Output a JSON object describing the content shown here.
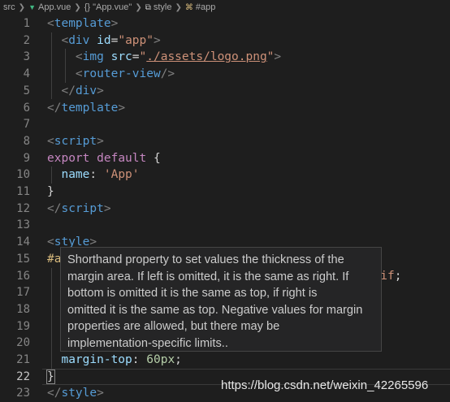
{
  "breadcrumb": {
    "items": [
      "src",
      "App.vue",
      "{} \"App.vue\"",
      "style",
      "#app"
    ]
  },
  "code_lines": [
    {
      "number": "1",
      "tokens": [
        {
          "t": "<",
          "c": "punc"
        },
        {
          "t": "template",
          "c": "tag"
        },
        {
          "t": ">",
          "c": "punc"
        }
      ]
    },
    {
      "number": "2",
      "tokens": [
        {
          "t": "  ",
          "c": "plain"
        },
        {
          "t": "<",
          "c": "punc"
        },
        {
          "t": "div",
          "c": "tag"
        },
        {
          "t": " ",
          "c": "plain"
        },
        {
          "t": "id",
          "c": "attr"
        },
        {
          "t": "=",
          "c": "plain"
        },
        {
          "t": "\"app\"",
          "c": "str"
        },
        {
          "t": ">",
          "c": "punc"
        }
      ]
    },
    {
      "number": "3",
      "tokens": [
        {
          "t": "    ",
          "c": "plain"
        },
        {
          "t": "<",
          "c": "punc"
        },
        {
          "t": "img",
          "c": "tag"
        },
        {
          "t": " ",
          "c": "plain"
        },
        {
          "t": "src",
          "c": "attr"
        },
        {
          "t": "=",
          "c": "plain"
        },
        {
          "t": "\"",
          "c": "str"
        },
        {
          "t": "./assets/logo.png",
          "c": "str link"
        },
        {
          "t": "\"",
          "c": "str"
        },
        {
          "t": ">",
          "c": "punc"
        }
      ]
    },
    {
      "number": "4",
      "tokens": [
        {
          "t": "    ",
          "c": "plain"
        },
        {
          "t": "<",
          "c": "punc"
        },
        {
          "t": "router-view",
          "c": "tag"
        },
        {
          "t": "/>",
          "c": "punc"
        }
      ]
    },
    {
      "number": "5",
      "tokens": [
        {
          "t": "  ",
          "c": "plain"
        },
        {
          "t": "</",
          "c": "punc"
        },
        {
          "t": "div",
          "c": "tag"
        },
        {
          "t": ">",
          "c": "punc"
        }
      ]
    },
    {
      "number": "6",
      "tokens": [
        {
          "t": "</",
          "c": "punc"
        },
        {
          "t": "template",
          "c": "tag"
        },
        {
          "t": ">",
          "c": "punc"
        }
      ]
    },
    {
      "number": "7",
      "tokens": []
    },
    {
      "number": "8",
      "tokens": [
        {
          "t": "<",
          "c": "punc"
        },
        {
          "t": "script",
          "c": "tag"
        },
        {
          "t": ">",
          "c": "punc"
        }
      ]
    },
    {
      "number": "9",
      "tokens": [
        {
          "t": "export",
          "c": "kw"
        },
        {
          "t": " ",
          "c": "plain"
        },
        {
          "t": "default",
          "c": "kw"
        },
        {
          "t": " {",
          "c": "plain"
        }
      ]
    },
    {
      "number": "10",
      "tokens": [
        {
          "t": "  ",
          "c": "plain"
        },
        {
          "t": "name",
          "c": "key"
        },
        {
          "t": ": ",
          "c": "plain"
        },
        {
          "t": "'App'",
          "c": "str"
        }
      ]
    },
    {
      "number": "11",
      "tokens": [
        {
          "t": "}",
          "c": "plain"
        }
      ]
    },
    {
      "number": "12",
      "tokens": [
        {
          "t": "</",
          "c": "punc"
        },
        {
          "t": "script",
          "c": "tag"
        },
        {
          "t": ">",
          "c": "punc"
        }
      ]
    },
    {
      "number": "13",
      "tokens": []
    },
    {
      "number": "14",
      "tokens": [
        {
          "t": "<",
          "c": "punc"
        },
        {
          "t": "style",
          "c": "tag"
        },
        {
          "t": ">",
          "c": "punc"
        }
      ]
    },
    {
      "number": "15",
      "tokens": [
        {
          "t": "#a",
          "c": "sel"
        }
      ]
    },
    {
      "number": "16",
      "tokens": [
        {
          "t": "                                             ",
          "c": "plain"
        },
        {
          "t": "erif",
          "c": "str"
        },
        {
          "t": ";",
          "c": "plain"
        }
      ]
    },
    {
      "number": "17",
      "tokens": []
    },
    {
      "number": "18",
      "tokens": []
    },
    {
      "number": "19",
      "tokens": []
    },
    {
      "number": "20",
      "tokens": []
    },
    {
      "number": "21",
      "tokens": [
        {
          "t": "  ",
          "c": "plain"
        },
        {
          "t": "margin-top",
          "c": "key"
        },
        {
          "t": ": ",
          "c": "plain"
        },
        {
          "t": "60px",
          "c": "num"
        },
        {
          "t": ";",
          "c": "plain"
        }
      ]
    },
    {
      "number": "22",
      "tokens": [
        {
          "t": "}",
          "c": "plain bracket"
        }
      ]
    },
    {
      "number": "23",
      "tokens": [
        {
          "t": "</",
          "c": "punc"
        },
        {
          "t": "style",
          "c": "tag"
        },
        {
          "t": ">",
          "c": "punc"
        }
      ]
    }
  ],
  "current_line": "22",
  "tooltip": {
    "lines": [
      "Shorthand property to set values the thickness of the",
      "margin area. If left is omitted, it is the same as right. If",
      "bottom is omitted it is the same as top, if right is",
      "omitted it is the same as top. Negative values for margin",
      "properties are allowed, but there may be",
      "implementation-specific limits.."
    ]
  },
  "watermark": "https://blog.csdn.net/weixin_42265596",
  "colors": {
    "background": "#1e1e1e",
    "tag": "#569cd6",
    "attribute": "#9cdcfe",
    "string": "#ce9178",
    "keyword": "#c586c0",
    "number": "#b5cea8",
    "selector": "#d7ba7d"
  }
}
